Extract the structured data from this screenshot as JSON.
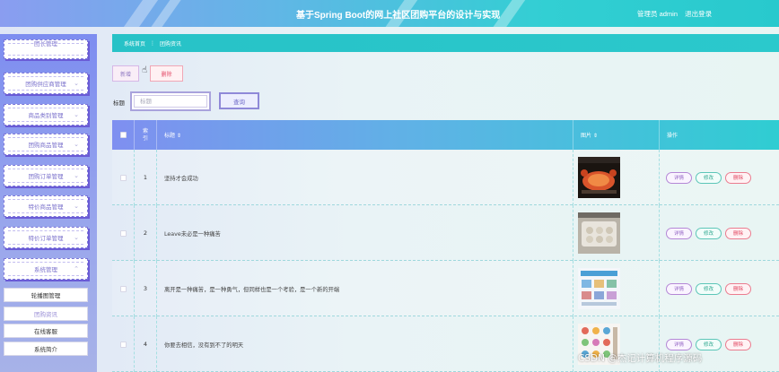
{
  "header": {
    "title": "基于Spring Boot的网上社区团购平台的设计与实现",
    "user_label": "管理员 admin",
    "logout_label": "退出登录"
  },
  "sidebar": {
    "items": [
      {
        "label": "团长管理"
      },
      {
        "label": "团购供应商管理"
      },
      {
        "label": "商品类别管理"
      },
      {
        "label": "团购商品管理"
      },
      {
        "label": "团购订单管理"
      },
      {
        "label": "特价商品管理"
      },
      {
        "label": "特价订单管理"
      },
      {
        "label": "系统管理"
      }
    ],
    "sub_items": [
      {
        "label": "轮播图管理"
      },
      {
        "label": "团购资讯"
      },
      {
        "label": "在线客服"
      },
      {
        "label": "系统简介"
      }
    ]
  },
  "breadcrumb": {
    "home": "系统首页",
    "separator": "⋮",
    "current": "团购资讯"
  },
  "toolbar": {
    "add_label": "新增",
    "delete_label": "删除"
  },
  "search": {
    "label": "标题",
    "placeholder": "标题",
    "button_label": "查询"
  },
  "table": {
    "headers": {
      "index": "索引",
      "title": "标题 ⇕",
      "picture": "图片 ⇕",
      "action": "操作"
    },
    "rows": [
      {
        "index": "1",
        "title": "坚持才会成功",
        "picture": "crab-image"
      },
      {
        "index": "2",
        "title": "Leave未必是一种痛苦",
        "picture": "food-tray-image"
      },
      {
        "index": "3",
        "title": "离开是一种痛苦，是一种勇气，但同样也是一个考验，是一个新的开端",
        "picture": "product-display-image"
      },
      {
        "index": "4",
        "title": "你要去相信，没有到不了的明天",
        "picture": "products-collage-image"
      }
    ],
    "actions": {
      "detail": "详情",
      "edit": "修改",
      "delete": "删除"
    }
  },
  "watermark": "CSDN @杰记计算机程序源码",
  "colors": {
    "header_gradient_start": "#8a9df0",
    "header_gradient_end": "#28c9cd",
    "breadcrumb_bg": "#27c2c7",
    "sidebar_bg": "#7d8df0",
    "delete_red": "#e0455e",
    "edit_teal": "#2ea78f",
    "detail_purple": "#9262c4"
  }
}
